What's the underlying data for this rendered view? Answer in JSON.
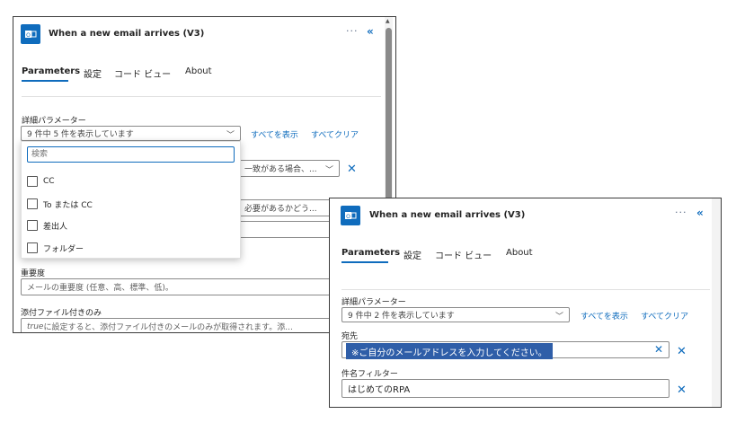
{
  "panelA": {
    "title": "When a new email arrives (V3)",
    "more": "···",
    "collapse": "«",
    "tabs": [
      "Parameters",
      "設定",
      "コード ビュー",
      "About"
    ],
    "adv_label": "詳細パラメーター",
    "adv_value": "9 件中 5 件を表示しています",
    "show_all": "すべてを表示",
    "clear_all": "すべてクリア",
    "dropdown": {
      "search_placeholder": "検索",
      "options": [
        "CC",
        "To または CC",
        "差出人",
        "フォルダー"
      ]
    },
    "hidden_field1": "一致がある場合、...",
    "hidden_field2": "必要があるかどう...",
    "importance_label": "重要度",
    "importance_placeholder": "メールの重要度 (任意、高、標準、低)。",
    "attach_label": "添付ファイル付きのみ",
    "attach_placeholder_em": "true",
    "attach_placeholder": " に設定すると、添付ファイル付きのメールのみが取得されます。添..."
  },
  "panelB": {
    "title": "When a new email arrives (V3)",
    "more": "···",
    "collapse": "«",
    "tabs": [
      "Parameters",
      "設定",
      "コード ビュー",
      "About"
    ],
    "adv_label": "詳細パラメーター",
    "adv_value": "9 件中 2 件を表示しています",
    "show_all": "すべてを表示",
    "clear_all": "すべてクリア",
    "to_label": "宛先",
    "to_tooltip": "※ご自分のメールアドレスを入力してください。",
    "subject_label": "件名フィルター",
    "subject_value": "はじめてのRPA"
  },
  "colors": {
    "accent": "#0f6cbd",
    "tooltip_bg": "#2f5ea8"
  },
  "icons": [
    "outlook-icon",
    "more-icon",
    "collapse-icon",
    "chevron-down-icon",
    "close-icon"
  ]
}
